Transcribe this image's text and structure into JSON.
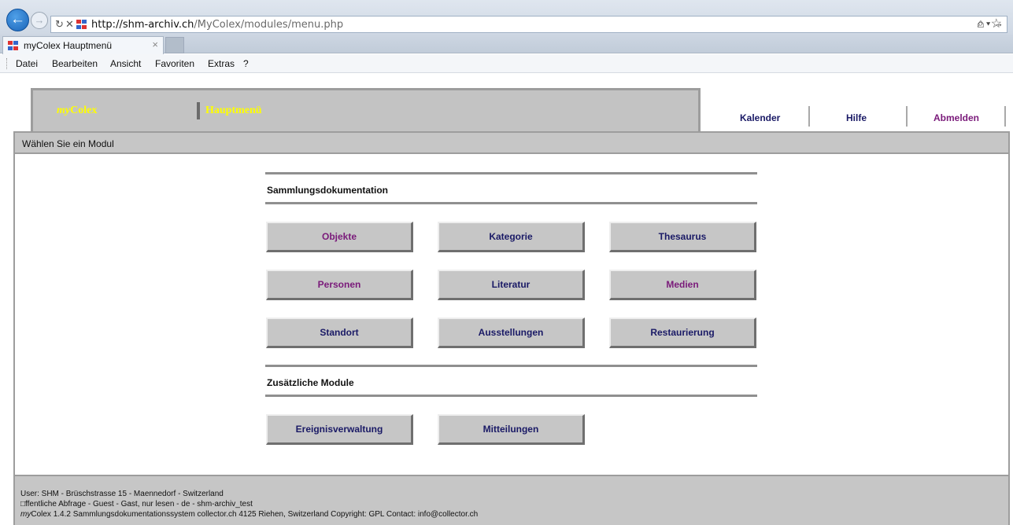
{
  "browser": {
    "url_host": "http://shm-archiv.ch",
    "url_path": "/MyColex/modules/menu.php",
    "addr_right": "⌕ ▾ →",
    "tab_title": "myColex Hauptmenü",
    "tab_close": "×",
    "menu": [
      "Datei",
      "Bearbeiten",
      "Ansicht",
      "Favoriten",
      "Extras",
      "?"
    ]
  },
  "header": {
    "brand_prefix": "my",
    "brand_suffix": "Colex",
    "module_title": "Hauptmenü",
    "nav": [
      {
        "label": "Kalender",
        "color": "#1a1a66"
      },
      {
        "label": "Hilfe",
        "color": "#1a1a66"
      },
      {
        "label": "Abmelden",
        "color": "#7a1a7a"
      }
    ],
    "subtitle": "Wählen Sie ein Modul"
  },
  "sections": {
    "main": {
      "title": "Sammlungsdokumentation",
      "buttons": [
        {
          "label": "Objekte",
          "color": "#7a1a7a"
        },
        {
          "label": "Kategorie",
          "color": "#1a1a66"
        },
        {
          "label": "Thesaurus",
          "color": "#1a1a66"
        },
        {
          "label": "Personen",
          "color": "#7a1a7a"
        },
        {
          "label": "Literatur",
          "color": "#1a1a66"
        },
        {
          "label": "Medien",
          "color": "#7a1a7a"
        },
        {
          "label": "Standort",
          "color": "#1a1a66"
        },
        {
          "label": "Ausstellungen",
          "color": "#1a1a66"
        },
        {
          "label": "Restaurierung",
          "color": "#1a1a66"
        }
      ]
    },
    "extra": {
      "title": "Zusätzliche Module",
      "buttons": [
        {
          "label": "Ereignisverwaltung",
          "color": "#1a1a66"
        },
        {
          "label": "Mitteilungen",
          "color": "#1a1a66"
        }
      ]
    }
  },
  "footer": {
    "line1": "User: SHM - Brüschstrasse 15 - Maennedorf - Switzerland",
    "line2": "□ffentliche Abfrage - Guest - Gast, nur lesen - de - shm-archiv_test",
    "line3_prefix": "my",
    "line3_rest": "Colex 1.4.2 Sammlungsdokumentationssystem collector.ch 4125 Riehen, Switzerland Copyright: GPL Contact: info@collector.ch"
  }
}
